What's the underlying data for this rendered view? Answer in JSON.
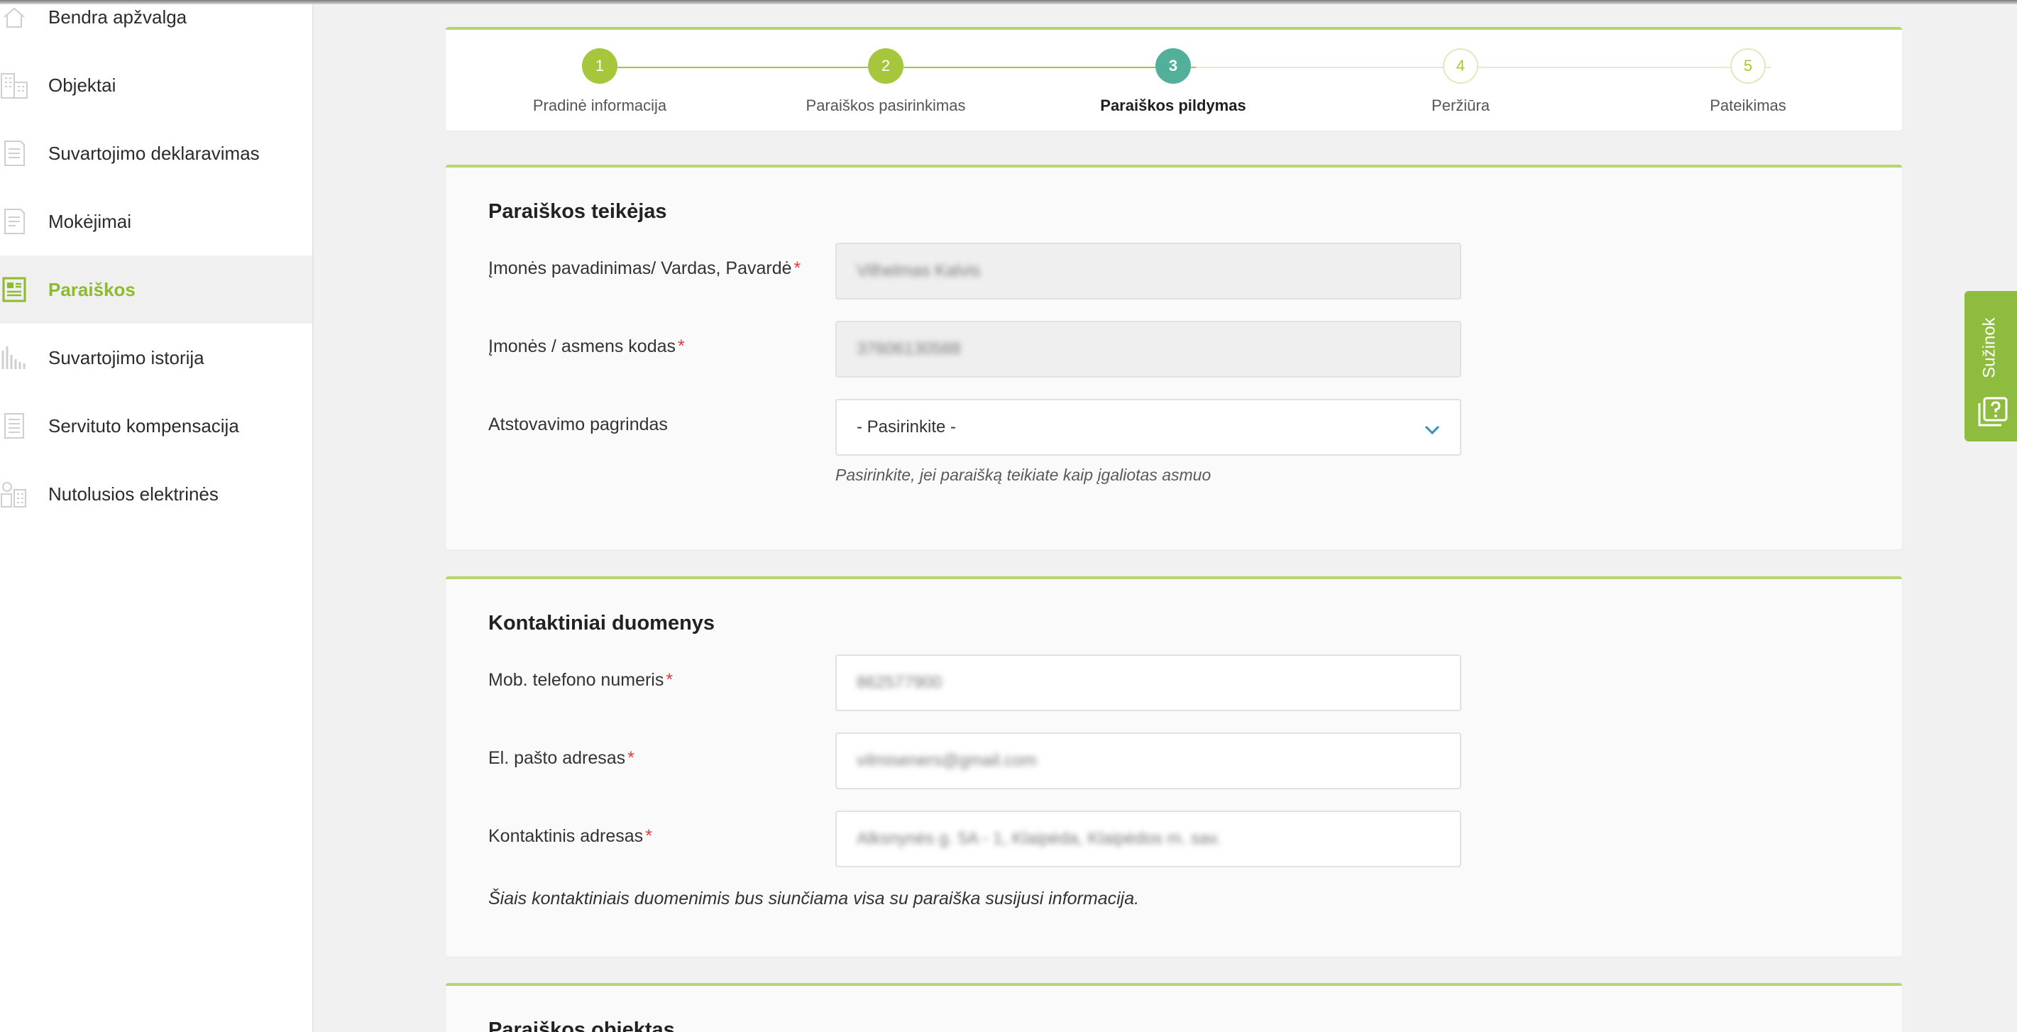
{
  "sidebar": {
    "items": [
      {
        "label": "Bendra apžvalga",
        "icon": "home-icon",
        "active": false
      },
      {
        "label": "Objektai",
        "icon": "buildings-icon",
        "active": false
      },
      {
        "label": "Suvartojimo deklaravimas",
        "icon": "document-icon",
        "active": false
      },
      {
        "label": "Mokėjimai",
        "icon": "receipt-icon",
        "active": false
      },
      {
        "label": "Paraiškos",
        "icon": "application-icon",
        "active": true
      },
      {
        "label": "Suvartojimo istorija",
        "icon": "bar-chart-icon",
        "active": false
      },
      {
        "label": "Servituto kompensacija",
        "icon": "document-lines-icon",
        "active": false
      },
      {
        "label": "Nutolusios elektrinės",
        "icon": "power-plant-icon",
        "active": false
      }
    ]
  },
  "stepper": {
    "steps": [
      {
        "number": "1",
        "label": "Pradinė informacija",
        "state": "done"
      },
      {
        "number": "2",
        "label": "Paraiškos pasirinkimas",
        "state": "done"
      },
      {
        "number": "3",
        "label": "Paraiškos pildymas",
        "state": "current"
      },
      {
        "number": "4",
        "label": "Peržiūra",
        "state": "todo"
      },
      {
        "number": "5",
        "label": "Pateikimas",
        "state": "todo"
      }
    ]
  },
  "applicant": {
    "title": "Paraiškos teikėjas",
    "company_name": {
      "label": "Įmonės pavadinimas/ Vardas, Pavardė",
      "required": "*",
      "value": "Vilhelmas Kalvis"
    },
    "company_code": {
      "label": "Įmonės / asmens kodas",
      "required": "*",
      "value": "37606130588"
    },
    "representation": {
      "label": "Atstovavimo pagrindas",
      "value": "- Pasirinkite -",
      "hint": "Pasirinkite, jei paraišką teikiate kaip įgaliotas asmuo"
    }
  },
  "contacts": {
    "title": "Kontaktiniai duomenys",
    "phone": {
      "label": "Mob. telefono numeris",
      "required": "*",
      "value": "862577900"
    },
    "email": {
      "label": "El. pašto adresas",
      "required": "*",
      "value": "vilmiseners@gmail.com"
    },
    "address": {
      "label": "Kontaktinis adresas",
      "required": "*",
      "value": "Alksnynės g. 5A - 1, Klaipėda, Klaipėdos m. sav."
    },
    "note": "Šiais kontaktiniais duomenimis bus siunčiama visa su paraiška susijusi informacija."
  },
  "object_section": {
    "title": "Paraiškos objektas"
  },
  "help_tab": {
    "label": "Sužinok",
    "icon": "help-question-icon"
  },
  "colors": {
    "accent_green": "#a6c63b",
    "current_step_teal": "#52b09a",
    "required_red": "#e23b3b"
  }
}
